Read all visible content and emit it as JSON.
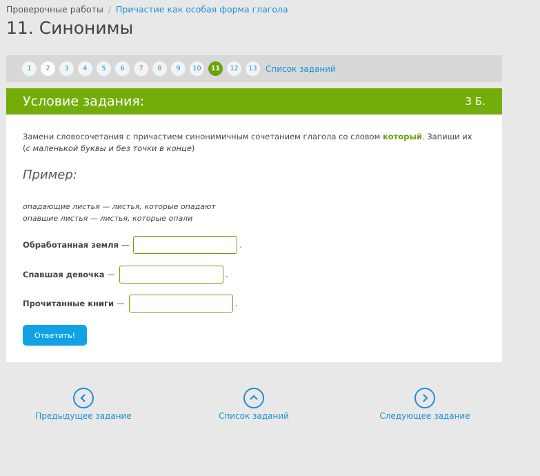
{
  "breadcrumb": {
    "root": "Проверочные работы",
    "separator": "/",
    "current": "Причастие как особая форма глагола"
  },
  "page_title": "11. Синонимы",
  "pager": {
    "pages": [
      "1",
      "2",
      "3",
      "4",
      "5",
      "6",
      "7",
      "8",
      "9",
      "10",
      "11",
      "12",
      "13"
    ],
    "active": "11",
    "all_tasks": "Список заданий"
  },
  "card": {
    "header": "Условие задания:",
    "points": "3 Б.",
    "task_text_1": "Замени словосочетания с причастием синонимичным сочетанием глагола со словом ",
    "task_keyword": "который",
    "task_text_2": ". Запиши их (",
    "task_italic": "с маленькой буквы и без точки в конце",
    "task_text_3": ")",
    "example_heading": "Пример:",
    "example_line1": "опадающие листья — листья, которые опадают",
    "example_line2": "опавшие листья — листья, которые опали",
    "rows": [
      {
        "label": "Обработанная земля",
        "dash": "—",
        "value": "",
        "end": "."
      },
      {
        "label": "Спавшая девочка",
        "dash": "—",
        "value": "",
        "end": "."
      },
      {
        "label": "Прочитанные книги",
        "dash": "—",
        "value": "",
        "end": "."
      }
    ],
    "submit_label": "Ответить!"
  },
  "nav": {
    "prev": "Предыдущее задание",
    "list": "Список заданий",
    "next": "Следующее задание",
    "prev_icon": "chevron-left-icon",
    "list_icon": "chevron-up-icon",
    "next_icon": "chevron-right-icon"
  },
  "colors": {
    "accent_green": "#73ad0a",
    "link_blue": "#1a8fd6",
    "button_blue": "#11a2e6"
  }
}
